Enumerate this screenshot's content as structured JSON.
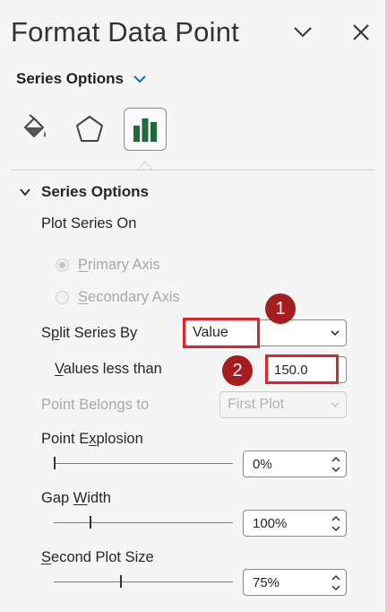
{
  "header": {
    "title": "Format Data Point",
    "collapse_icon": "chevron-down-icon",
    "close_icon": "close-icon"
  },
  "options_dropdown": {
    "label": "Series Options"
  },
  "tabs": [
    {
      "name": "Fill & Line",
      "icon": "paint-bucket-icon"
    },
    {
      "name": "Effects",
      "icon": "pentagon-icon"
    },
    {
      "name": "Series Options",
      "icon": "bar-chart-icon",
      "selected": true
    }
  ],
  "section": {
    "title": "Series Options"
  },
  "plot_series_on": {
    "label": "Plot Series On",
    "primary": {
      "label_pre": "",
      "label_ul": "P",
      "label_post": "rimary Axis",
      "checked": true
    },
    "secondary": {
      "label_pre": "",
      "label_ul": "S",
      "label_post": "econdary Axis",
      "checked": false
    }
  },
  "split_series_by": {
    "label_pre": "S",
    "label_ul": "p",
    "label_post": "lit Series By",
    "value": "Value"
  },
  "values_less_than": {
    "label_pre": "",
    "label_ul": "V",
    "label_post": "alues less than",
    "value": "150.0"
  },
  "point_belongs_to": {
    "label": "Point Belongs to",
    "value": "First Plot"
  },
  "point_explosion": {
    "label_pre": "Point E",
    "label_ul": "x",
    "label_post": "plosion",
    "value": "0%",
    "level": 0
  },
  "gap_width": {
    "label_pre": "Gap ",
    "label_ul": "W",
    "label_post": "idth",
    "value": "100%",
    "level": 0.2
  },
  "second_plot_size": {
    "label_pre": "",
    "label_ul": "S",
    "label_post": "econd Plot Size",
    "value": "75%",
    "level": 0.37
  },
  "callouts": [
    "1",
    "2"
  ],
  "colors": {
    "highlight": "#e0222b",
    "badge": "#a51d1f",
    "accent": "#0f6cbd",
    "chart_icon": "#1e6b3c"
  }
}
